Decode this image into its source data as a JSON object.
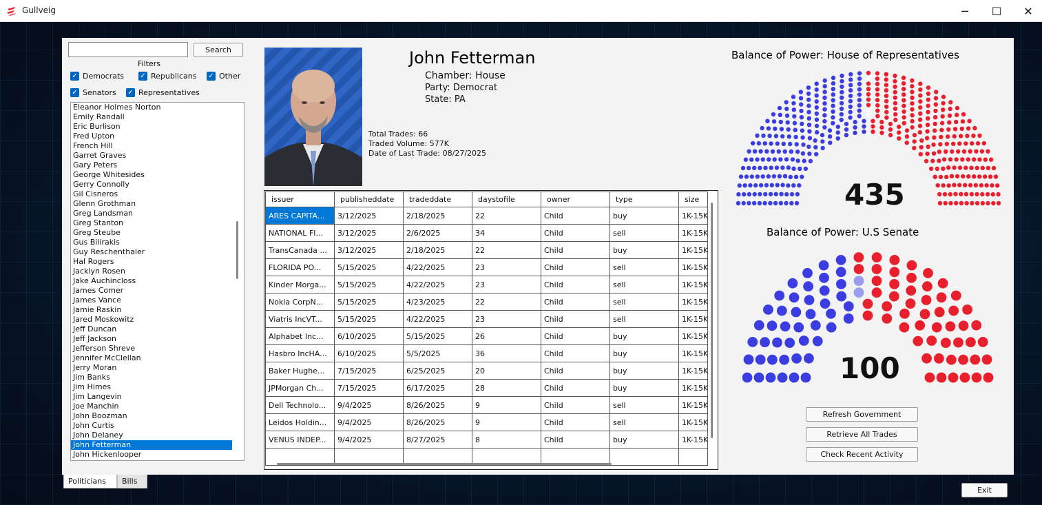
{
  "window": {
    "title": "Gullveig",
    "minimize": "─",
    "maximize": "☐",
    "close": "✕"
  },
  "search": {
    "value": "",
    "button": "Search"
  },
  "filters": {
    "title": "Filters",
    "democrats": "Democrats",
    "republicans": "Republicans",
    "other": "Other",
    "senators": "Senators",
    "representatives": "Representatives"
  },
  "politicians": [
    "Eleanor Holmes Norton",
    "Emily Randall",
    "Eric Burlison",
    "Fred Upton",
    "French Hill",
    "Garret Graves",
    "Gary Peters",
    "George Whitesides",
    "Gerry Connolly",
    "Gil Cisneros",
    "Glenn Grothman",
    "Greg Landsman",
    "Greg Stanton",
    "Greg Steube",
    "Gus Bilirakis",
    "Guy Reschenthaler",
    "Hal Rogers",
    "Jacklyn Rosen",
    "Jake Auchincloss",
    "James Comer",
    "James Vance",
    "Jamie Raskin",
    "Jared Moskowitz",
    "Jeff Duncan",
    "Jeff Jackson",
    "Jefferson Shreve",
    "Jennifer McClellan",
    "Jerry Moran",
    "Jim Banks",
    "Jim Himes",
    "Jim Langevin",
    "Joe Manchin",
    "John Boozman",
    "John Curtis",
    "John Delaney",
    "John Fetterman",
    "John Hickenlooper"
  ],
  "selected_politician": "John Fetterman",
  "profile": {
    "name": "John Fetterman",
    "chamber": "Chamber: House",
    "party": "Party: Democrat",
    "state": "State: PA",
    "total_trades": "Total Trades: 66",
    "traded_volume": "Traded Volume: 577K",
    "last_trade": "Date of Last Trade: 08/27/2025"
  },
  "trades": {
    "columns": [
      "issuer",
      "publisheddate",
      "tradeddate",
      "daystofile",
      "owner",
      "type",
      "size"
    ],
    "rows": [
      [
        "ARES CAPITA...",
        "3/12/2025",
        "2/18/2025",
        "22",
        "Child",
        "buy",
        "1K-15K"
      ],
      [
        "NATIONAL FI...",
        "3/12/2025",
        "2/6/2025",
        "34",
        "Child",
        "sell",
        "1K-15K"
      ],
      [
        "TransCanada ...",
        "3/12/2025",
        "2/18/2025",
        "22",
        "Child",
        "buy",
        "1K-15K"
      ],
      [
        "FLORIDA PO...",
        "5/15/2025",
        "4/22/2025",
        "23",
        "Child",
        "sell",
        "1K-15K"
      ],
      [
        "Kinder Morga...",
        "5/15/2025",
        "4/22/2025",
        "23",
        "Child",
        "sell",
        "1K-15K"
      ],
      [
        "Nokia CorpN...",
        "5/15/2025",
        "4/23/2025",
        "22",
        "Child",
        "sell",
        "1K-15K"
      ],
      [
        "Viatris IncVT...",
        "5/15/2025",
        "4/22/2025",
        "23",
        "Child",
        "sell",
        "1K-15K"
      ],
      [
        "Alphabet Inc...",
        "6/10/2025",
        "5/15/2025",
        "26",
        "Child",
        "buy",
        "1K-15K"
      ],
      [
        "Hasbro IncHA...",
        "6/10/2025",
        "5/5/2025",
        "36",
        "Child",
        "buy",
        "1K-15K"
      ],
      [
        "Baker Hughe...",
        "7/15/2025",
        "6/25/2025",
        "20",
        "Child",
        "buy",
        "1K-15K"
      ],
      [
        "JPMorgan Ch...",
        "7/15/2025",
        "6/17/2025",
        "28",
        "Child",
        "buy",
        "1K-15K"
      ],
      [
        "Dell Technolo...",
        "9/4/2025",
        "8/26/2025",
        "9",
        "Child",
        "sell",
        "1K-15K"
      ],
      [
        "Leidos Holdin...",
        "9/4/2025",
        "8/26/2025",
        "9",
        "Child",
        "sell",
        "1K-15K"
      ],
      [
        "VENUS INDEP...",
        "9/4/2025",
        "8/27/2025",
        "8",
        "Child",
        "buy",
        "1K-15K"
      ]
    ]
  },
  "house": {
    "title": "Balance of Power: House of Representatives",
    "total": "435",
    "democrats": 213,
    "vacant": 3,
    "republicans": 219
  },
  "senate": {
    "title": "Balance of Power: U.S Senate",
    "total": "100",
    "democrats": 45,
    "independents": 2,
    "republicans": 53
  },
  "colors": {
    "democrat": "#3b3de0",
    "republican": "#e8202e",
    "independent": "#9a9cf0",
    "vacant": "#ffffff"
  },
  "actions": {
    "refresh": "Refresh Government",
    "retrieve": "Retrieve All Trades",
    "recent": "Check Recent Activity"
  },
  "tabs": {
    "politicians": "Politicians",
    "bills": "Bills"
  },
  "exit": "Exit"
}
